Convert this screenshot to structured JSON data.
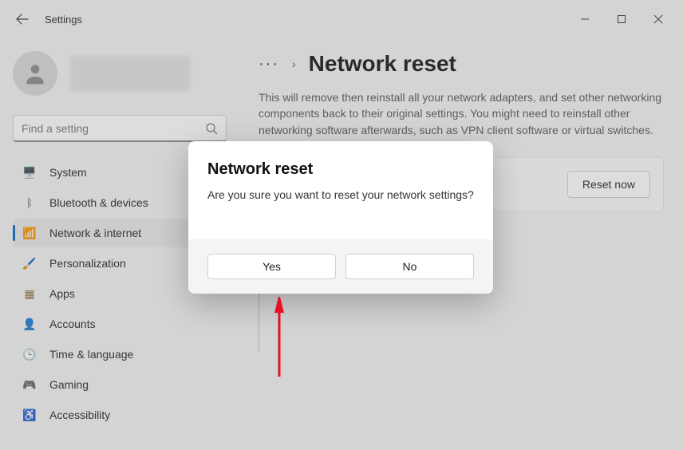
{
  "window": {
    "title": "Settings"
  },
  "search": {
    "placeholder": "Find a setting"
  },
  "nav": {
    "items": [
      {
        "label": "System",
        "icon": "🖥️",
        "color": "#0078d4"
      },
      {
        "label": "Bluetooth & devices",
        "icon": "ᛒ",
        "color": "#444"
      },
      {
        "label": "Network & internet",
        "icon": "📶",
        "color": "#0067c0"
      },
      {
        "label": "Personalization",
        "icon": "🖌️",
        "color": "#d83b6a"
      },
      {
        "label": "Apps",
        "icon": "▦",
        "color": "#8a6f3a"
      },
      {
        "label": "Accounts",
        "icon": "👤",
        "color": "#2e8b57"
      },
      {
        "label": "Time & language",
        "icon": "🕒",
        "color": "#444"
      },
      {
        "label": "Gaming",
        "icon": "🎮",
        "color": "#555"
      },
      {
        "label": "Accessibility",
        "icon": "♿",
        "color": "#1a6fb0"
      }
    ],
    "selected_index": 2
  },
  "breadcrumb": {
    "more": "···",
    "chevron": "›",
    "title": "Network reset"
  },
  "description": "This will remove then reinstall all your network adapters, and set other networking components back to their original settings. You might need to reinstall other networking software afterwards, such as VPN client software or virtual switches.",
  "reset_button": "Reset now",
  "dialog": {
    "title": "Network reset",
    "message": "Are you sure you want to reset your network settings?",
    "yes": "Yes",
    "no": "No"
  }
}
